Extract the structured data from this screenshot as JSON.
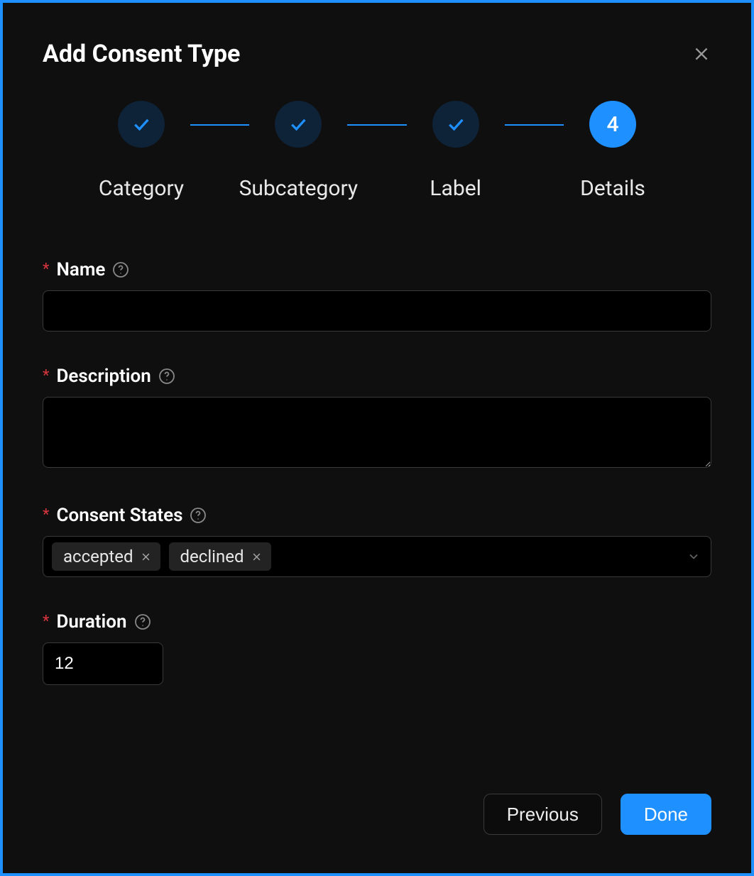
{
  "modal": {
    "title": "Add Consent Type"
  },
  "stepper": {
    "steps": [
      {
        "label": "Category",
        "completed": true
      },
      {
        "label": "Subcategory",
        "completed": true
      },
      {
        "label": "Label",
        "completed": true
      },
      {
        "label": "Details",
        "index": "4",
        "active": true
      }
    ]
  },
  "form": {
    "name": {
      "label": "Name",
      "value": ""
    },
    "description": {
      "label": "Description",
      "value": ""
    },
    "consent_states": {
      "label": "Consent States",
      "tags": [
        "accepted",
        "declined"
      ]
    },
    "duration": {
      "label": "Duration",
      "value": "12"
    }
  },
  "footer": {
    "previous_label": "Previous",
    "done_label": "Done"
  },
  "colors": {
    "accent": "#1e90ff",
    "required": "#d9363e"
  }
}
